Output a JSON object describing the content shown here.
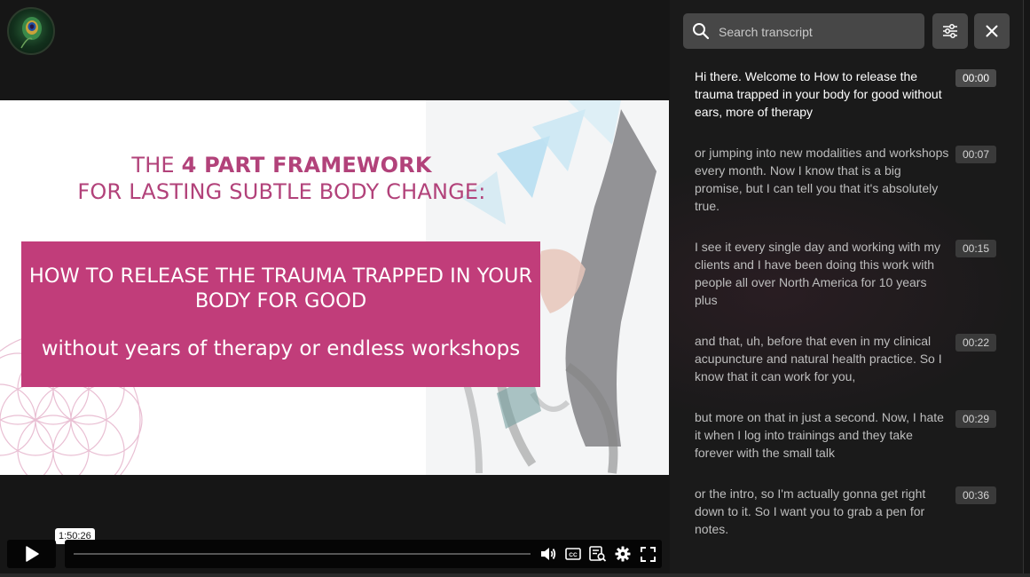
{
  "player": {
    "current_time_tooltip": "1:50:26",
    "progress_fraction": 0.0
  },
  "slide": {
    "heading_line1_prefix": "THE ",
    "heading_line1_bold": "4 PART FRAMEWORK",
    "heading_line2": "FOR LASTING SUBTLE BODY CHANGE:",
    "box_line1": "HOW TO RELEASE THE TRAUMA TRAPPED IN YOUR BODY FOR GOOD",
    "box_line2": "without years of therapy or endless workshops"
  },
  "transcript": {
    "search_placeholder": "Search transcript",
    "segments": [
      {
        "text": "Hi there. Welcome to How to release the trauma trapped in your body for good without ears, more of therapy",
        "time": "00:00"
      },
      {
        "text": "or jumping into new modalities and workshops every month. Now I know that is a big promise, but I can tell you that it's absolutely true.",
        "time": "00:07"
      },
      {
        "text": "I see it every single day and working with my clients and I have been doing this work with people all over North America for 10 years plus",
        "time": "00:15"
      },
      {
        "text": "and that, uh, before that even in my clinical acupuncture and natural health practice. So I know that it can work for you,",
        "time": "00:22"
      },
      {
        "text": "but more on that in just a second. Now, I hate it when I log into trainings and they take forever with the small talk",
        "time": "00:29"
      },
      {
        "text": "or the intro, so I'm actually gonna get right down to it. So I want you to grab a pen for notes.",
        "time": "00:36"
      }
    ]
  },
  "colors": {
    "accent_pink": "#c13d7a",
    "heading_pink": "#b2427a",
    "panel_bg": "#1a1a1a"
  },
  "icons": {
    "search": "search-icon",
    "settings_sliders": "sliders-icon",
    "close": "close-icon",
    "play": "play-icon",
    "volume": "volume-icon",
    "captions": "captions-icon",
    "transcript": "transcript-icon",
    "settings": "gear-icon",
    "fullscreen": "fullscreen-icon"
  }
}
